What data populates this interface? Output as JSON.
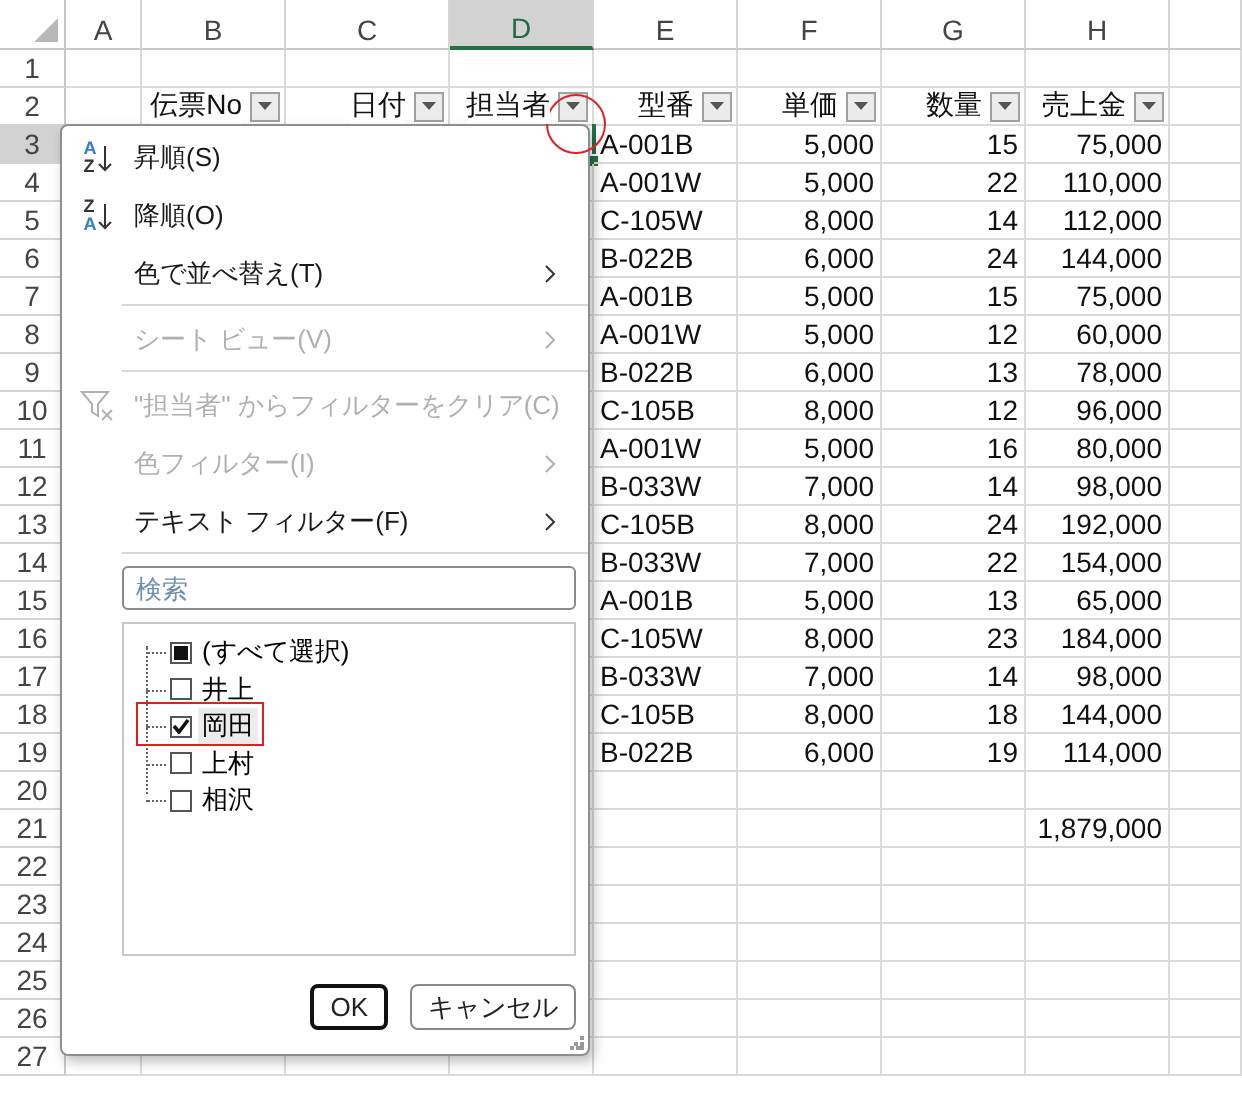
{
  "column_headers": [
    {
      "label": "A",
      "selected": false
    },
    {
      "label": "B",
      "selected": false
    },
    {
      "label": "C",
      "selected": false
    },
    {
      "label": "D",
      "selected": true
    },
    {
      "label": "E",
      "selected": false
    },
    {
      "label": "F",
      "selected": false
    },
    {
      "label": "G",
      "selected": false
    },
    {
      "label": "H",
      "selected": false
    }
  ],
  "rows": [
    {
      "number": "1",
      "selected": false
    },
    {
      "number": "2",
      "selected": false,
      "headers": [
        {
          "label": "伝票No",
          "circled": false
        },
        {
          "label": "日付",
          "circled": false
        },
        {
          "label": "担当者",
          "circled": true
        },
        {
          "label": "型番",
          "circled": false
        },
        {
          "label": "単価",
          "circled": false
        },
        {
          "label": "数量",
          "circled": false
        },
        {
          "label": "売上金",
          "circled": false
        }
      ]
    },
    {
      "number": "3",
      "selected": true,
      "cells": {
        "E": "A-001B",
        "F": "5,000",
        "G": "15",
        "H": "75,000"
      }
    },
    {
      "number": "4",
      "selected": false,
      "cells": {
        "E": "A-001W",
        "F": "5,000",
        "G": "22",
        "H": "110,000"
      }
    },
    {
      "number": "5",
      "selected": false,
      "cells": {
        "E": "C-105W",
        "F": "8,000",
        "G": "14",
        "H": "112,000"
      }
    },
    {
      "number": "6",
      "selected": false,
      "cells": {
        "E": "B-022B",
        "F": "6,000",
        "G": "24",
        "H": "144,000"
      }
    },
    {
      "number": "7",
      "selected": false,
      "cells": {
        "E": "A-001B",
        "F": "5,000",
        "G": "15",
        "H": "75,000"
      }
    },
    {
      "number": "8",
      "selected": false,
      "cells": {
        "E": "A-001W",
        "F": "5,000",
        "G": "12",
        "H": "60,000"
      }
    },
    {
      "number": "9",
      "selected": false,
      "cells": {
        "E": "B-022B",
        "F": "6,000",
        "G": "13",
        "H": "78,000"
      }
    },
    {
      "number": "10",
      "selected": false,
      "cells": {
        "E": "C-105B",
        "F": "8,000",
        "G": "12",
        "H": "96,000"
      }
    },
    {
      "number": "11",
      "selected": false,
      "cells": {
        "E": "A-001W",
        "F": "5,000",
        "G": "16",
        "H": "80,000"
      }
    },
    {
      "number": "12",
      "selected": false,
      "cells": {
        "E": "B-033W",
        "F": "7,000",
        "G": "14",
        "H": "98,000"
      }
    },
    {
      "number": "13",
      "selected": false,
      "cells": {
        "E": "C-105B",
        "F": "8,000",
        "G": "24",
        "H": "192,000"
      }
    },
    {
      "number": "14",
      "selected": false,
      "cells": {
        "E": "B-033W",
        "F": "7,000",
        "G": "22",
        "H": "154,000"
      }
    },
    {
      "number": "15",
      "selected": false,
      "cells": {
        "E": "A-001B",
        "F": "5,000",
        "G": "13",
        "H": "65,000"
      }
    },
    {
      "number": "16",
      "selected": false,
      "cells": {
        "E": "C-105W",
        "F": "8,000",
        "G": "23",
        "H": "184,000"
      }
    },
    {
      "number": "17",
      "selected": false,
      "cells": {
        "E": "B-033W",
        "F": "7,000",
        "G": "14",
        "H": "98,000"
      }
    },
    {
      "number": "18",
      "selected": false,
      "cells": {
        "E": "C-105B",
        "F": "8,000",
        "G": "18",
        "H": "144,000"
      }
    },
    {
      "number": "19",
      "selected": false,
      "cells": {
        "E": "B-022B",
        "F": "6,000",
        "G": "19",
        "H": "114,000"
      }
    },
    {
      "number": "20",
      "selected": false
    },
    {
      "number": "21",
      "selected": false,
      "cells": {
        "H": "1,879,000"
      }
    },
    {
      "number": "22",
      "selected": false
    },
    {
      "number": "23",
      "selected": false
    },
    {
      "number": "24",
      "selected": false
    },
    {
      "number": "25",
      "selected": false
    },
    {
      "number": "26",
      "selected": false
    },
    {
      "number": "27",
      "selected": false
    }
  ],
  "filter_menu": {
    "items": [
      {
        "kind": "sort_ascending",
        "label": "昇順(S)",
        "icon_letters": [
          "A",
          "Z"
        ],
        "disabled": false,
        "submenu": false,
        "separator_after": false
      },
      {
        "kind": "sort_descending",
        "label": "降順(O)",
        "icon_letters": [
          "Z",
          "A"
        ],
        "disabled": false,
        "submenu": false,
        "separator_after": false
      },
      {
        "kind": "plain",
        "label": "色で並べ替え(T)",
        "disabled": false,
        "submenu": true,
        "separator_after": true
      },
      {
        "kind": "plain",
        "label": "シート ビュー(V)",
        "disabled": true,
        "submenu": true,
        "separator_after": true
      },
      {
        "kind": "clear_filter",
        "label": "\"担当者\" からフィルターをクリア(C)",
        "disabled": true,
        "submenu": false,
        "separator_after": false
      },
      {
        "kind": "plain",
        "label": "色フィルター(I)",
        "disabled": true,
        "submenu": true,
        "separator_after": false
      },
      {
        "kind": "plain",
        "label": "テキスト フィルター(F)",
        "disabled": false,
        "submenu": true,
        "separator_after": true
      }
    ],
    "search": {
      "placeholder": "検索"
    },
    "values": [
      {
        "label": "(すべて選択)",
        "checked": false,
        "partial": true,
        "highlighted": false
      },
      {
        "label": "井上",
        "checked": false,
        "partial": false,
        "highlighted": false
      },
      {
        "label": "岡田",
        "checked": true,
        "partial": false,
        "highlighted": true
      },
      {
        "label": "上村",
        "checked": false,
        "partial": false,
        "highlighted": false
      },
      {
        "label": "相沢",
        "checked": false,
        "partial": false,
        "highlighted": false
      }
    ],
    "buttons": [
      {
        "label": "OK",
        "default": true
      },
      {
        "label": "キャンセル",
        "default": false
      }
    ]
  }
}
